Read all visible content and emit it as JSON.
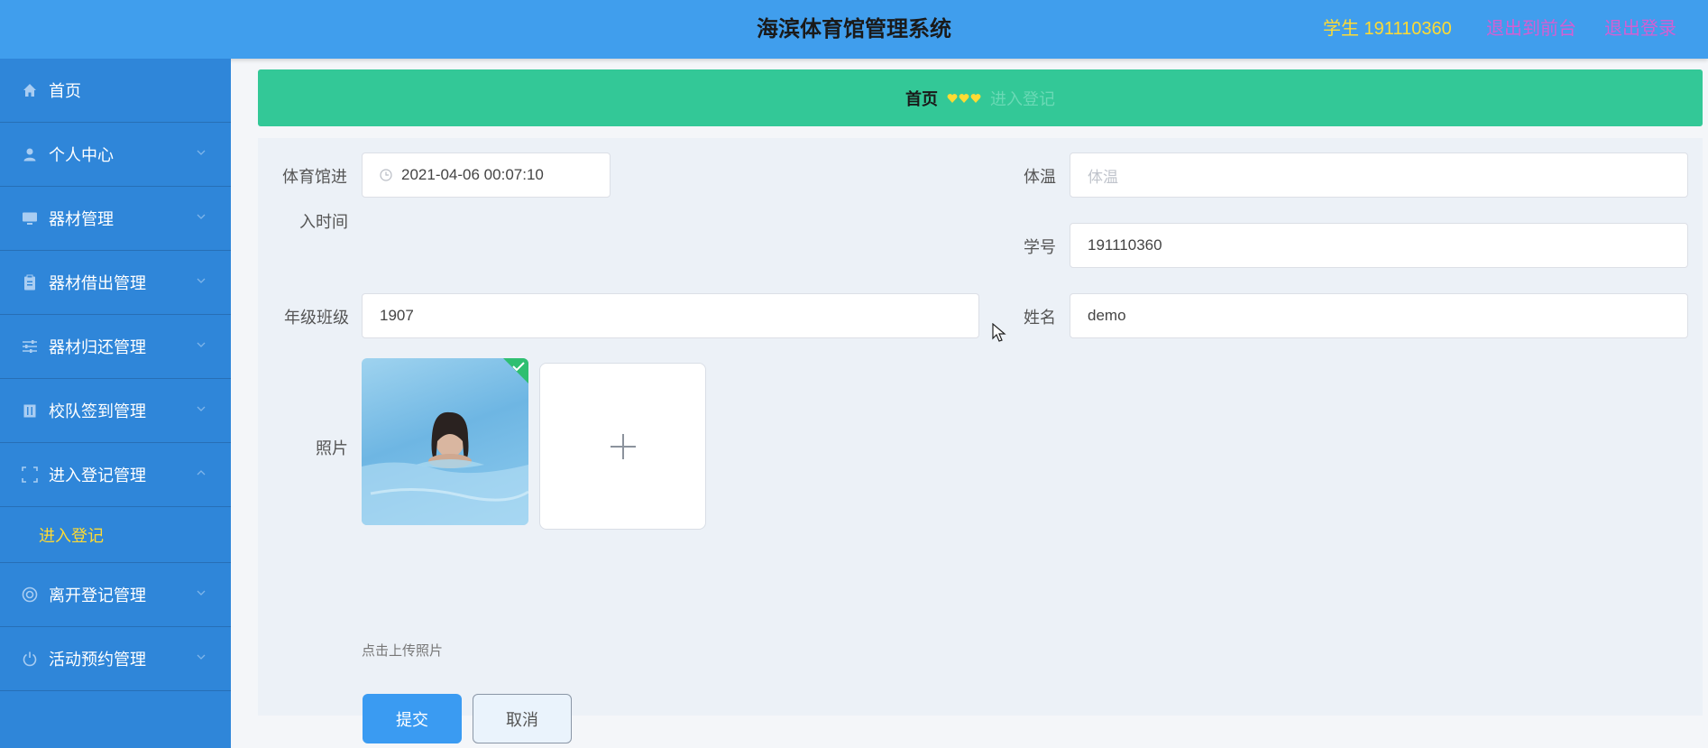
{
  "header": {
    "title": "海滨体育馆管理系统",
    "user_info": "学生 191110360",
    "back_to_front": "退出到前台",
    "logout": "退出登录"
  },
  "sidebar": {
    "items": [
      {
        "label": "首页",
        "icon": "home-icon"
      },
      {
        "label": "个人中心",
        "icon": "user-icon"
      },
      {
        "label": "器材管理",
        "icon": "monitor-icon"
      },
      {
        "label": "器材借出管理",
        "icon": "clipboard-icon"
      },
      {
        "label": "器材归还管理",
        "icon": "sliders-icon"
      },
      {
        "label": "校队签到管理",
        "icon": "building-icon"
      },
      {
        "label": "进入登记管理",
        "icon": "scan-icon"
      },
      {
        "label": "离开登记管理",
        "icon": "lifebuoy-icon"
      },
      {
        "label": "活动预约管理",
        "icon": "power-icon"
      }
    ],
    "sub_item": "进入登记"
  },
  "breadcrumb": {
    "home": "首页",
    "current": "进入登记"
  },
  "form": {
    "entry_time_label_line1": "体育馆进",
    "entry_time_label_line2": "入时间",
    "entry_time_value": "2021-04-06 00:07:10",
    "temperature_label": "体温",
    "temperature_placeholder": "体温",
    "student_id_label": "学号",
    "student_id_value": "191110360",
    "class_label": "年级班级",
    "class_value": "1907",
    "name_label": "姓名",
    "name_value": "demo",
    "photo_label": "照片",
    "upload_hint": "点击上传照片",
    "submit": "提交",
    "cancel": "取消"
  },
  "colors": {
    "header": "#409eed",
    "sidebar": "#2f86d9",
    "breadcrumb": "#33c897",
    "accent": "#ffdb33",
    "link": "#d35fd4",
    "primary_button": "#3a9bf2"
  }
}
